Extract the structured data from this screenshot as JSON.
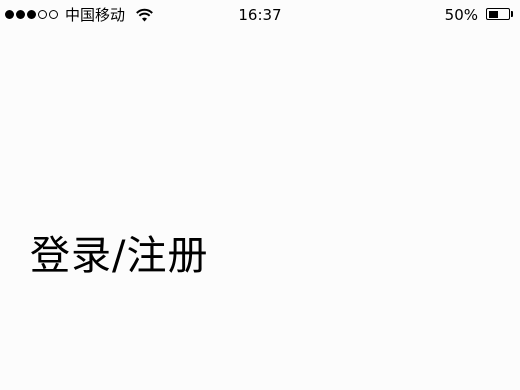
{
  "status_bar": {
    "signal": {
      "filled": 3,
      "total": 5
    },
    "carrier": "中国移动",
    "wifi_icon": "wifi-icon",
    "time": "16:37",
    "battery_percent_label": "50%",
    "battery_level": 0.5
  },
  "main": {
    "title": "登录/注册"
  },
  "colors": {
    "background": "#fcfcfc",
    "text": "#000000"
  }
}
